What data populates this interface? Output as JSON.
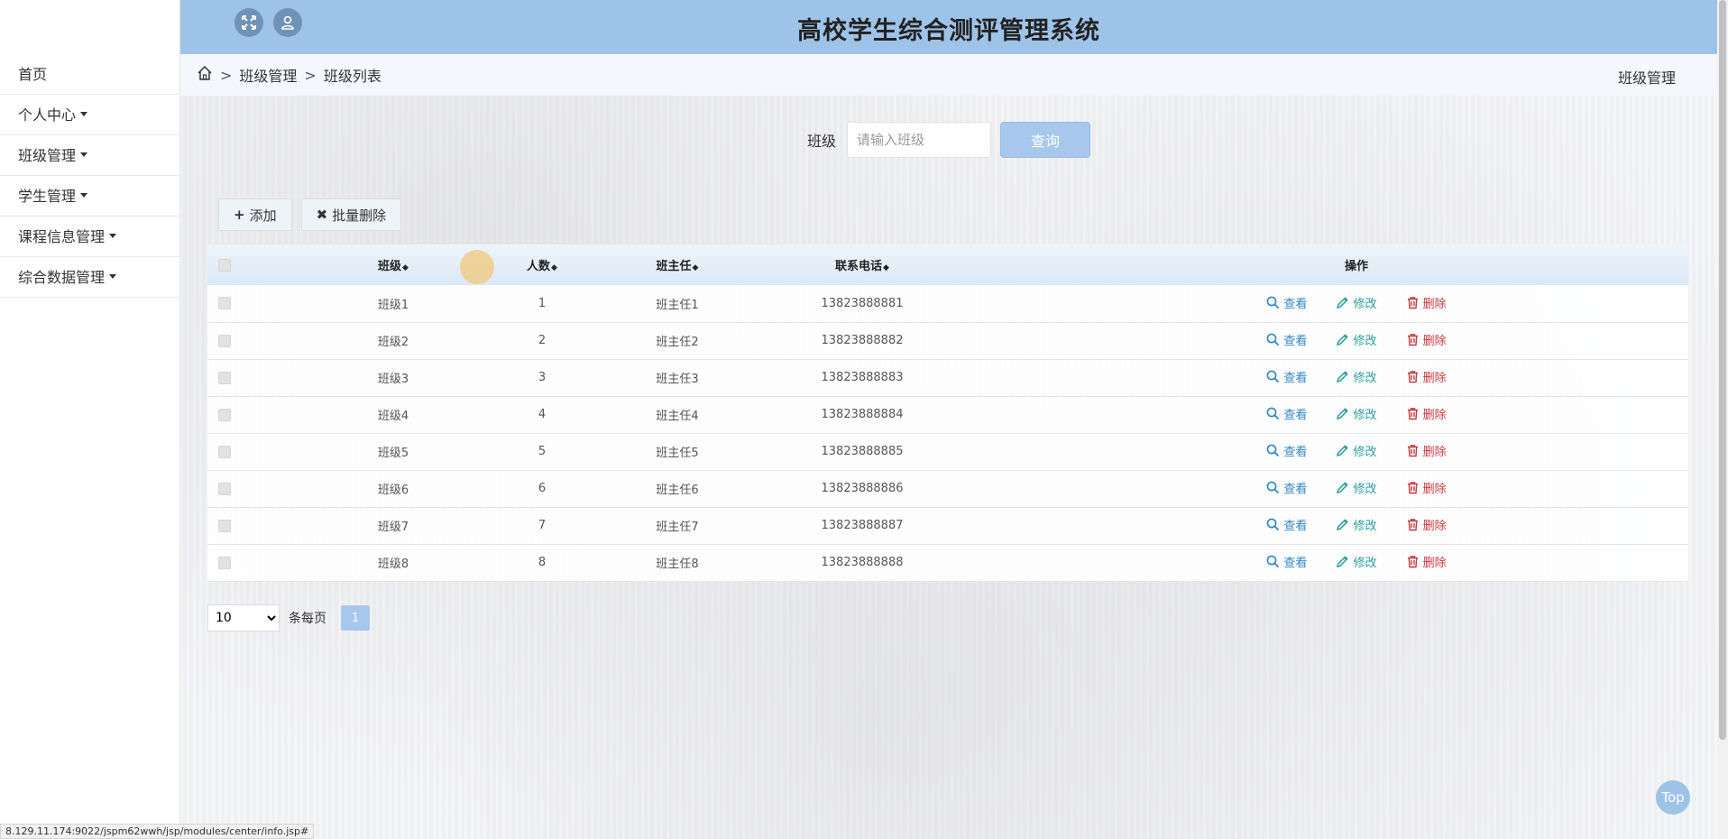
{
  "header": {
    "title": "高校学生综合测评管理系统"
  },
  "sidebar": {
    "items": [
      {
        "label": "首页",
        "dropdown": false
      },
      {
        "label": "个人中心",
        "dropdown": true
      },
      {
        "label": "班级管理",
        "dropdown": true
      },
      {
        "label": "学生管理",
        "dropdown": true
      },
      {
        "label": "课程信息管理",
        "dropdown": true
      },
      {
        "label": "综合数据管理",
        "dropdown": true
      }
    ]
  },
  "breadcrumb": {
    "sep": ">",
    "level1": "班级管理",
    "level2": "班级列表",
    "right_title": "班级管理"
  },
  "search": {
    "label": "班级",
    "placeholder": "请输入班级",
    "button": "查询"
  },
  "actions": {
    "add": "添加",
    "batch_delete": "批量删除"
  },
  "table": {
    "headers": {
      "class": "班级",
      "count": "人数",
      "teacher": "班主任",
      "phone": "联系电话",
      "ops": "操作"
    },
    "ops": {
      "view": "查看",
      "edit": "修改",
      "delete": "删除"
    },
    "rows": [
      {
        "class": "班级1",
        "count": "1",
        "teacher": "班主任1",
        "phone": "13823888881"
      },
      {
        "class": "班级2",
        "count": "2",
        "teacher": "班主任2",
        "phone": "13823888882"
      },
      {
        "class": "班级3",
        "count": "3",
        "teacher": "班主任3",
        "phone": "13823888883"
      },
      {
        "class": "班级4",
        "count": "4",
        "teacher": "班主任4",
        "phone": "13823888884"
      },
      {
        "class": "班级5",
        "count": "5",
        "teacher": "班主任5",
        "phone": "13823888885"
      },
      {
        "class": "班级6",
        "count": "6",
        "teacher": "班主任6",
        "phone": "13823888886"
      },
      {
        "class": "班级7",
        "count": "7",
        "teacher": "班主任7",
        "phone": "13823888887"
      },
      {
        "class": "班级8",
        "count": "8",
        "teacher": "班主任8",
        "phone": "13823888888"
      }
    ]
  },
  "pagination": {
    "page_size": "10",
    "per_page_label": "条每页",
    "current_page": "1"
  },
  "top_button": "Top",
  "status_url": "8.129.11.174:9022/jspm62wwh/jsp/modules/center/info.jsp#",
  "colors": {
    "header_bg": "#9ec3e8",
    "accent": "#a7c8ec",
    "view": "#2f86c7",
    "edit": "#2a9c9c",
    "delete": "#c8383f"
  }
}
